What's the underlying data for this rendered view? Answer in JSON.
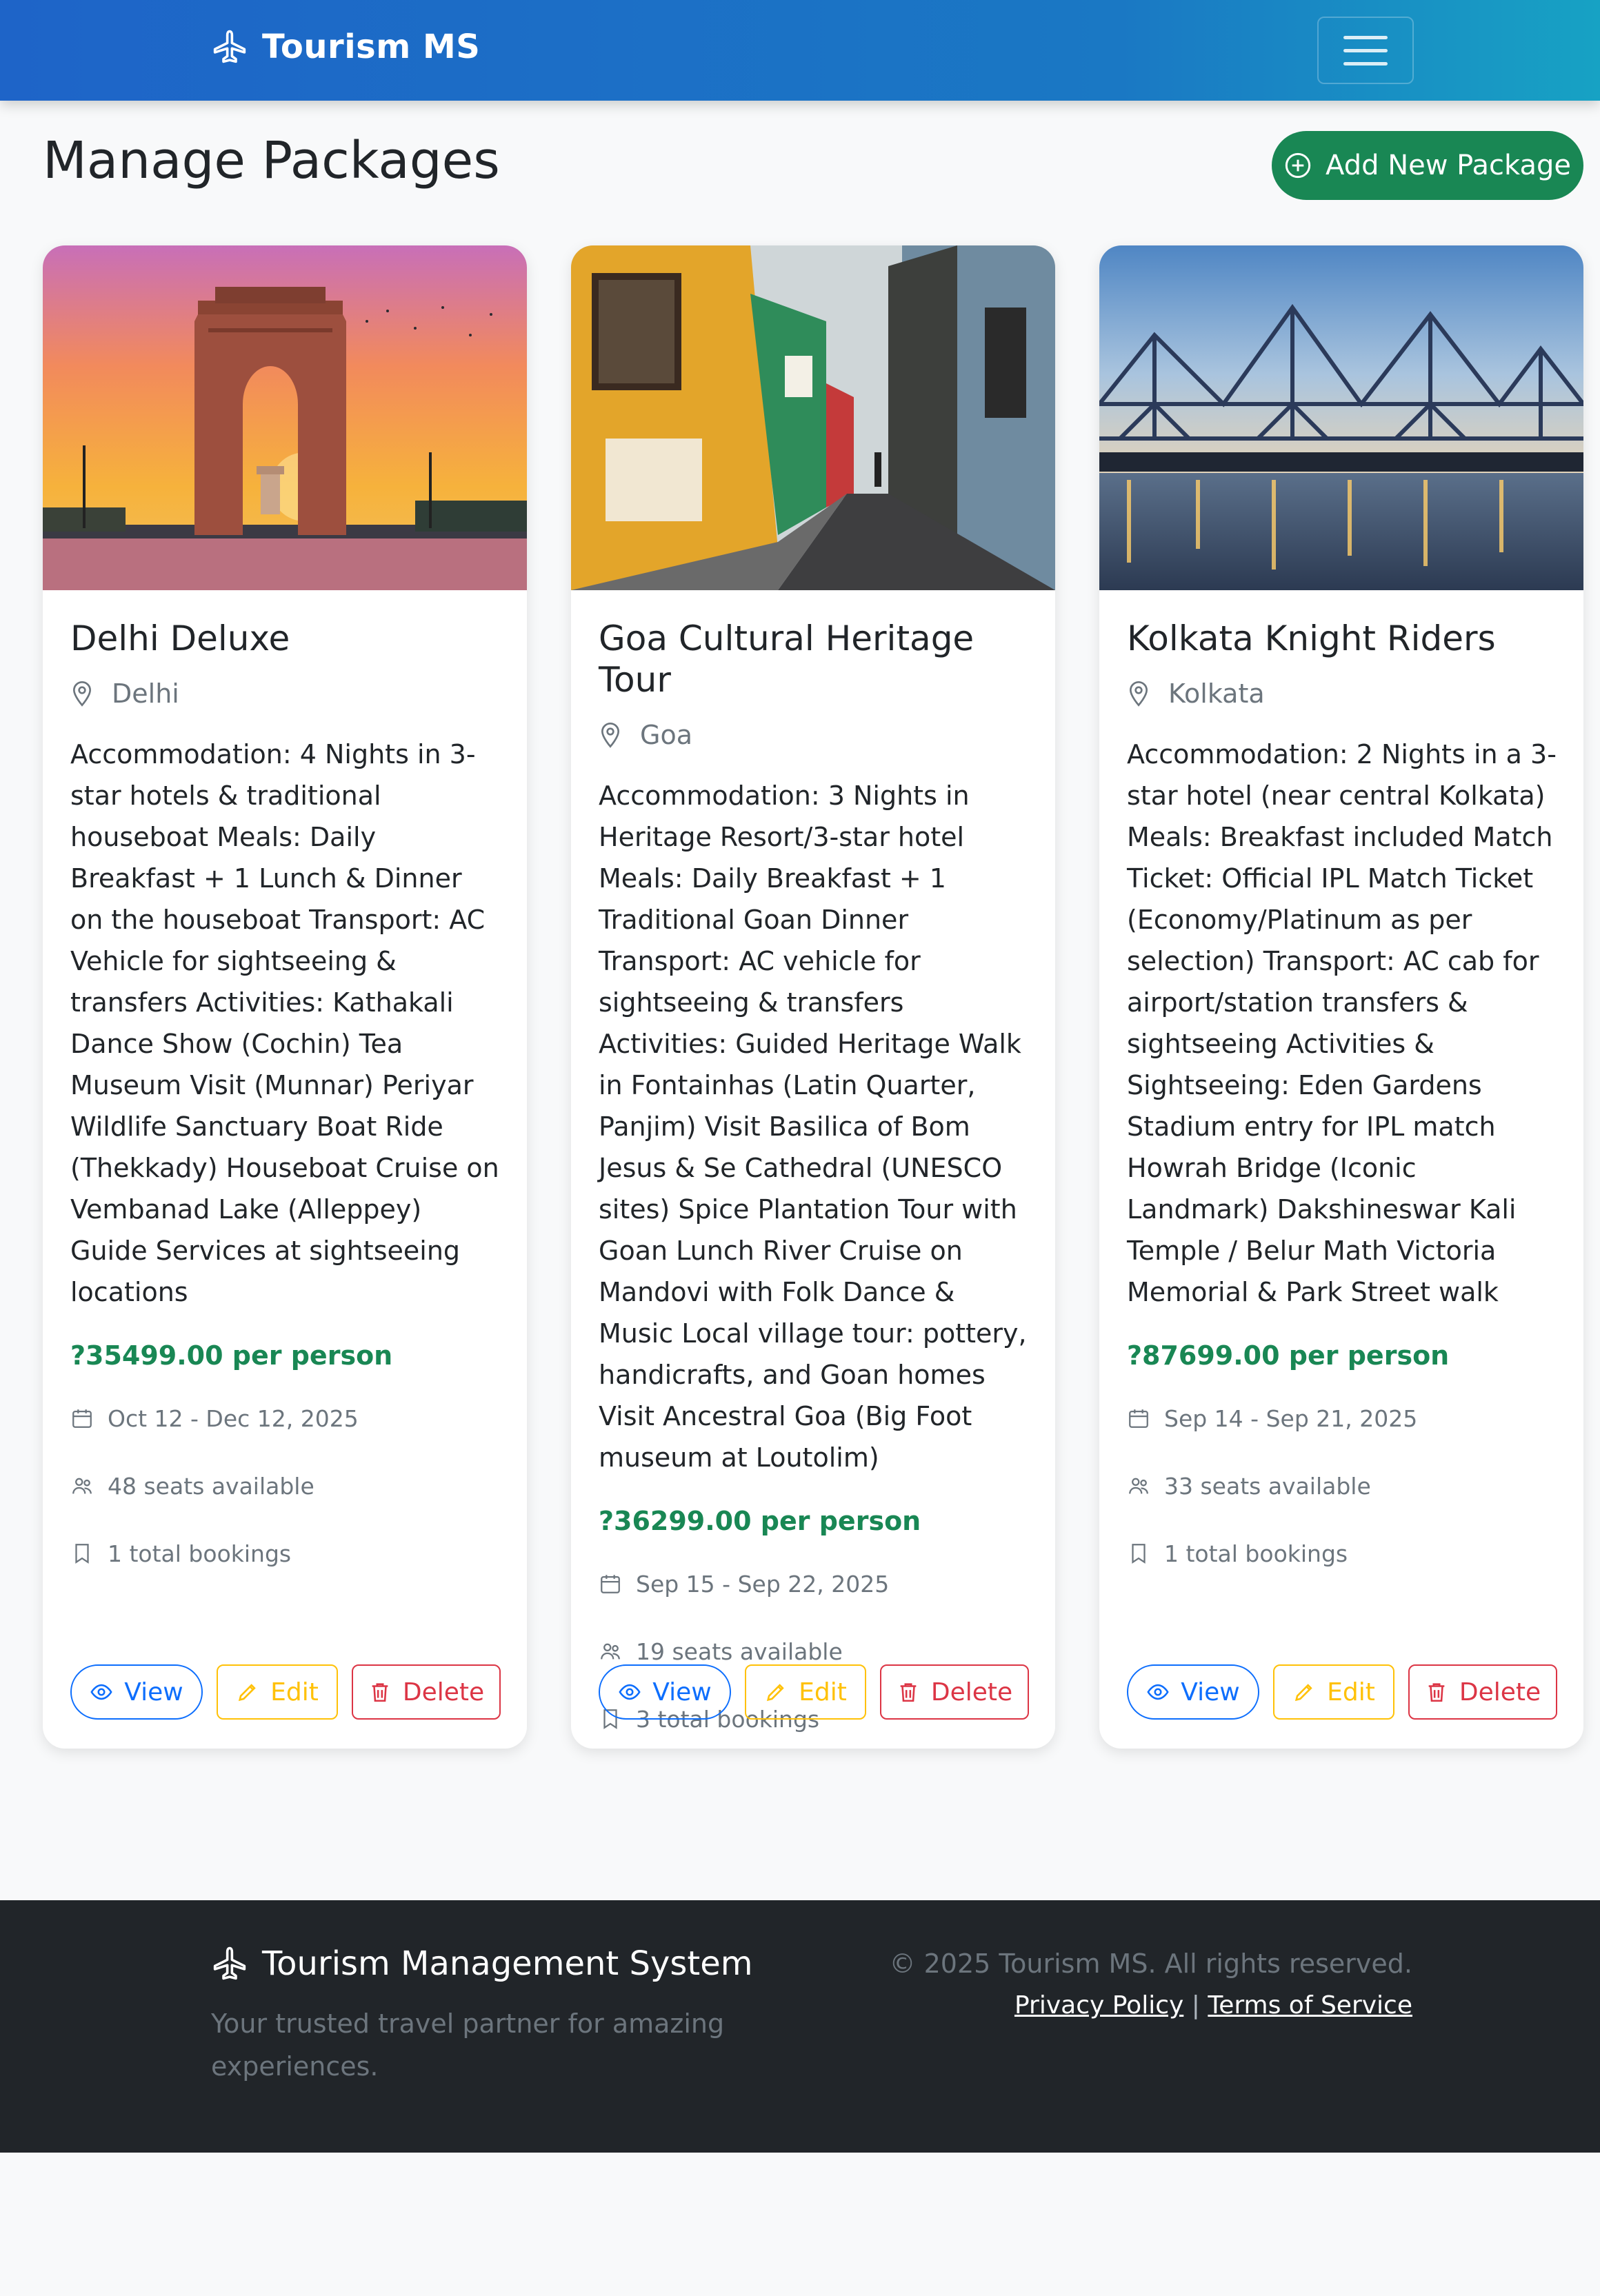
{
  "navbar": {
    "brand": "Tourism MS",
    "brand_icon": "airplane-icon",
    "toggler_icon": "hamburger-menu-icon"
  },
  "header": {
    "title": "Manage Packages",
    "add_button_label": "Add New Package",
    "add_button_icon": "plus-circle-icon"
  },
  "packages": [
    {
      "title": "Delhi Deluxe",
      "location": "Delhi",
      "image": "india-gate-sunset",
      "description": "Accommodation: 4 Nights in 3-star hotels & traditional houseboat Meals: Daily Breakfast + 1 Lunch & Dinner on the houseboat Transport: AC Vehicle for sightseeing & transfers Activities: Kathakali Dance Show (Cochin) Tea Museum Visit (Munnar) Periyar Wildlife Sanctuary Boat Ride (Thekkady) Houseboat Cruise on Vembanad Lake (Alleppey) Guide Services at sightseeing locations",
      "price": "?35499.00 per person",
      "dates": "Oct 12 - Dec 12, 2025",
      "seats": "48 seats available",
      "bookings": "1 total bookings"
    },
    {
      "title": "Goa Cultural Heritage Tour",
      "location": "Goa",
      "image": "goa-colorful-street",
      "description": "Accommodation: 3 Nights in Heritage Resort/3-star hotel Meals: Daily Breakfast + 1 Traditional Goan Dinner Transport: AC vehicle for sightseeing & transfers Activities: Guided Heritage Walk in Fontainhas (Latin Quarter, Panjim) Visit Basilica of Bom Jesus & Se Cathedral (UNESCO sites) Spice Plantation Tour with Goan Lunch River Cruise on Mandovi with Folk Dance & Music Local village tour: pottery, handicrafts, and Goan homes Visit Ancestral Goa (Big Foot museum at Loutolim)",
      "price": "?36299.00 per person",
      "dates": "Sep 15 - Sep 22, 2025",
      "seats": "19 seats available",
      "bookings": "3 total bookings"
    },
    {
      "title": "Kolkata Knight Riders",
      "location": "Kolkata",
      "image": "howrah-bridge-night",
      "description": "Accommodation: 2 Nights in a 3-star hotel (near central Kolkata) Meals: Breakfast included Match Ticket: Official IPL Match Ticket (Economy/Platinum as per selection) Transport: AC cab for airport/station transfers & sightseeing Activities & Sightseeing: Eden Gardens Stadium entry for IPL match Howrah Bridge (Iconic Landmark) Dakshineswar Kali Temple / Belur Math Victoria Memorial & Park Street walk",
      "price": "?87699.00 per person",
      "dates": "Sep 14 - Sep 21, 2025",
      "seats": "33 seats available",
      "bookings": "1 total bookings"
    }
  ],
  "card_actions": {
    "view": "View",
    "edit": "Edit",
    "delete": "Delete"
  },
  "footer": {
    "title": "Tourism Management System",
    "tagline": "Your trusted travel partner for amazing experiences.",
    "copyright": "© 2025 Tourism MS. All rights reserved.",
    "privacy": "Privacy Policy",
    "separator": "|",
    "terms": "Terms of Service"
  },
  "colors": {
    "primary": "#0d6efd",
    "success": "#198754",
    "warning": "#ffc107",
    "danger": "#dc3545",
    "dark": "#212529"
  }
}
